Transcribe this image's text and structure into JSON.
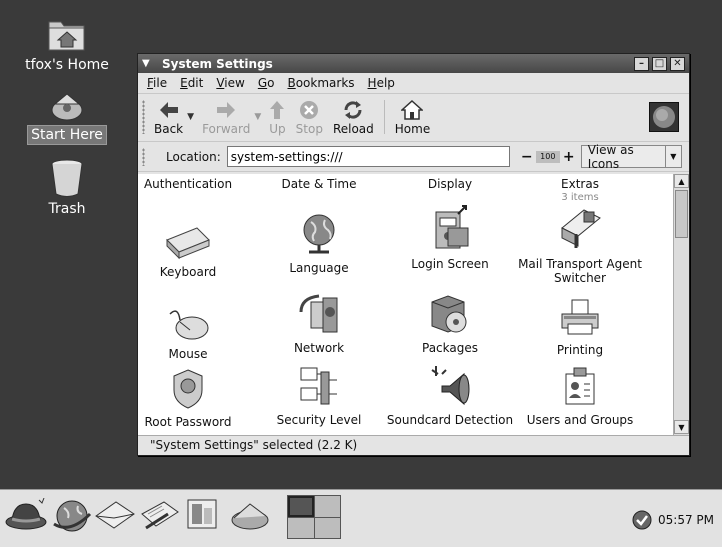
{
  "desktop": {
    "icons": [
      {
        "label": "tfox's Home"
      },
      {
        "label": "Start Here"
      },
      {
        "label": "Trash"
      }
    ]
  },
  "window": {
    "title": "System Settings",
    "menu": [
      {
        "accel": "F",
        "rest": "ile"
      },
      {
        "accel": "E",
        "rest": "dit"
      },
      {
        "accel": "V",
        "rest": "iew"
      },
      {
        "accel": "G",
        "rest": "o"
      },
      {
        "accel": "B",
        "rest": "ookmarks"
      },
      {
        "accel": "H",
        "rest": "elp"
      }
    ],
    "toolbar": {
      "back": "Back",
      "forward": "Forward",
      "up": "Up",
      "stop": "Stop",
      "reload": "Reload",
      "home": "Home"
    },
    "location": {
      "label": "Location:",
      "value": "system-settings:///",
      "zoom": "100",
      "view_as": "View as Icons"
    },
    "categories": [
      {
        "label": "Authentication"
      },
      {
        "label": "Date & Time"
      },
      {
        "label": "Display"
      },
      {
        "label": "Extras",
        "count": "3 items"
      }
    ],
    "items": [
      {
        "label": "Keyboard",
        "icon": "keyboard-icon"
      },
      {
        "label": "Language",
        "icon": "globe-icon"
      },
      {
        "label": "Login Screen",
        "icon": "login-screen-icon"
      },
      {
        "label": "Mail Transport Agent Switcher",
        "icon": "mail-icon"
      },
      {
        "label": "Mouse",
        "icon": "mouse-icon"
      },
      {
        "label": "Network",
        "icon": "network-icon"
      },
      {
        "label": "Packages",
        "icon": "packages-icon"
      },
      {
        "label": "Printing",
        "icon": "printer-icon"
      },
      {
        "label": "Root Password",
        "icon": "badge-icon"
      },
      {
        "label": "Security Level",
        "icon": "firewall-icon"
      },
      {
        "label": "Soundcard Detection",
        "icon": "speaker-icon"
      },
      {
        "label": "Users and Groups",
        "icon": "users-icon"
      }
    ],
    "status": "\"System Settings\" selected (2.2 K)"
  },
  "panel": {
    "clock": "05:57 PM"
  }
}
